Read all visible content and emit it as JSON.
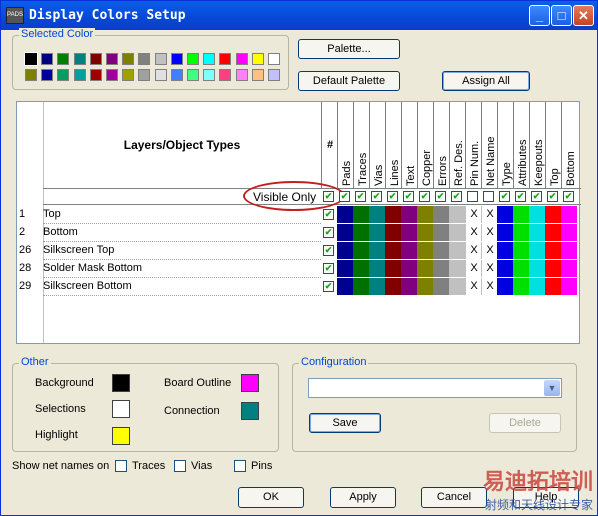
{
  "window": {
    "title": "Display Colors Setup",
    "app_icon_text": "PADS"
  },
  "selected_color": {
    "label": "Selected Color",
    "palette_rows": [
      [
        "#000000",
        "#000080",
        "#008000",
        "#008080",
        "#800000",
        "#800080",
        "#808000",
        "#808080",
        "#c0c0c0",
        "#0000ff",
        "#00ff00",
        "#00ffff",
        "#ff0000",
        "#ff00ff",
        "#ffff00",
        "#ffffff"
      ],
      [
        "#808000",
        "#0000a0",
        "#00a060",
        "#00a0a0",
        "#a00000",
        "#a000a0",
        "#a0a000",
        "#a0a0a0",
        "#e0e0e0",
        "#4080ff",
        "#40ff80",
        "#80ffff",
        "#ff4080",
        "#ff80ff",
        "#ffc080",
        "#c0c0ff"
      ]
    ]
  },
  "buttons": {
    "palette": "Palette...",
    "default_palette": "Default Palette",
    "assign_all": "Assign All",
    "save": "Save",
    "delete": "Delete",
    "ok": "OK",
    "apply": "Apply",
    "cancel": "Cancel",
    "help": "Help"
  },
  "grid": {
    "layers_header": "Layers/Object Types",
    "num_header": "#",
    "columns": [
      "Pads",
      "Traces",
      "Vias",
      "Lines",
      "Text",
      "Copper",
      "Errors",
      "Ref. Des.",
      "Pin Num.",
      "Net Name",
      "Type",
      "Attributes",
      "Keepouts",
      "Top",
      "Bottom"
    ],
    "visible_only_label": "Visible Only",
    "visible_row_checks": [
      true,
      true,
      true,
      true,
      true,
      true,
      true,
      true,
      false,
      false,
      true,
      true,
      true,
      true,
      true
    ],
    "column_colors": [
      "#000090",
      "#007000",
      "#008080",
      "#800000",
      "#800080",
      "#808000",
      "#808080",
      "#c0c0c0",
      "X",
      "X",
      "#0000e0",
      "#00e000",
      "#00e0e0",
      "#ff0000",
      "#ff00ff"
    ],
    "rows": [
      {
        "num": "1",
        "name": "Top"
      },
      {
        "num": "2",
        "name": "Bottom"
      },
      {
        "num": "26",
        "name": "Silkscreen Top"
      },
      {
        "num": "28",
        "name": "Solder Mask Bottom"
      },
      {
        "num": "29",
        "name": "Silkscreen Bottom"
      }
    ]
  },
  "other": {
    "label": "Other",
    "background": {
      "label": "Background",
      "color": "#000000"
    },
    "selections": {
      "label": "Selections",
      "color": "#ffffff"
    },
    "highlight": {
      "label": "Highlight",
      "color": "#ffff00"
    },
    "board_outline": {
      "label": "Board Outline",
      "color": "#ff00ff"
    },
    "connection": {
      "label": "Connection",
      "color": "#008080"
    }
  },
  "configuration": {
    "label": "Configuration",
    "value": ""
  },
  "show_net_names": {
    "label": "Show net names on",
    "traces": "Traces",
    "vias": "Vias",
    "pins": "Pins"
  },
  "watermark": {
    "line1": "易迪拓培训",
    "line2": "射频和天线设计专家"
  }
}
